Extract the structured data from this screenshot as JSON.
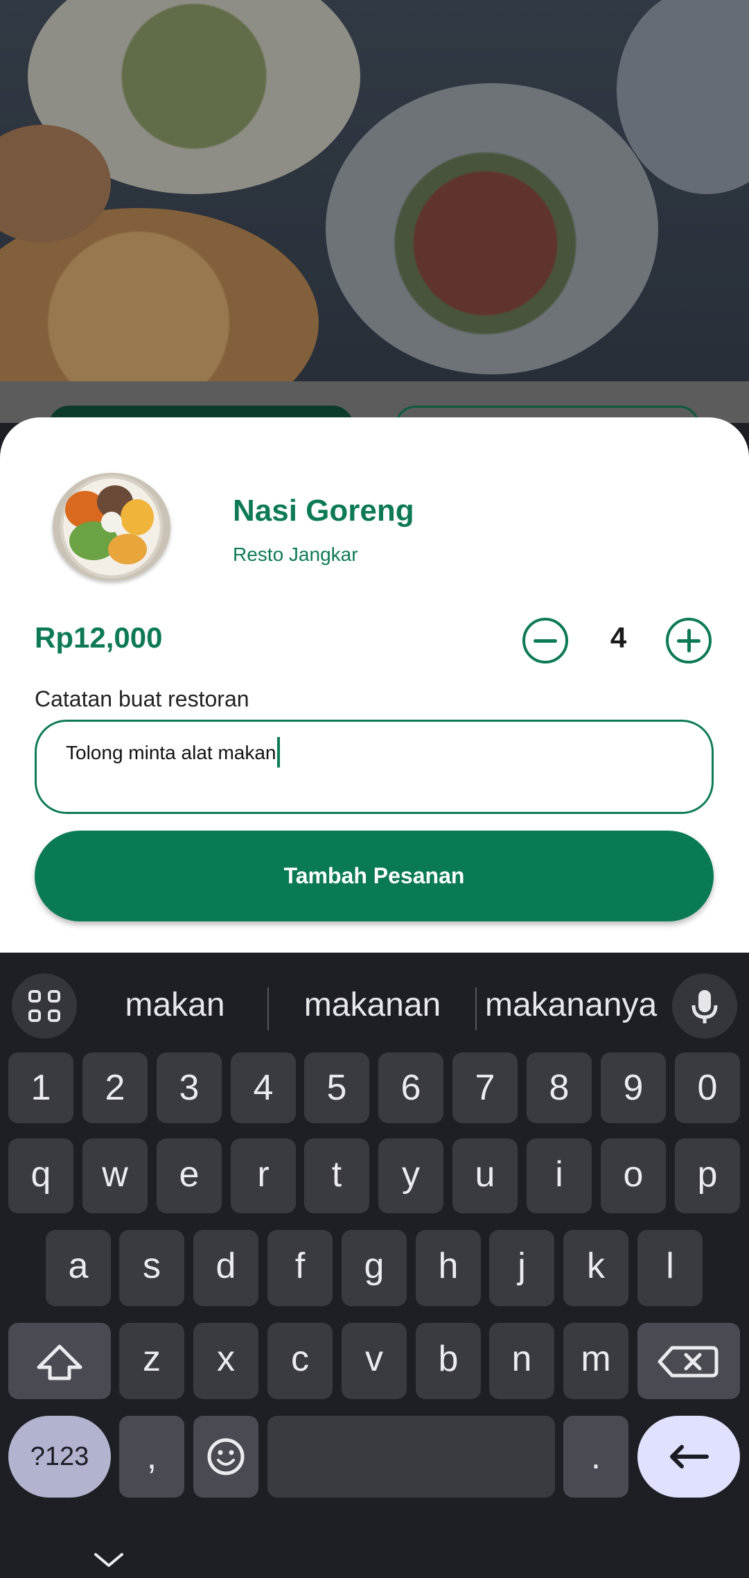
{
  "product": {
    "name": "Nasi Goreng",
    "restaurant": "Resto Jangkar",
    "price": "Rp12,000",
    "quantity": "4"
  },
  "note": {
    "label": "Catatan buat restoran",
    "value": "Tolong minta alat makan"
  },
  "actions": {
    "submit_label": "Tambah Pesanan",
    "decrease_icon": "minus-circle-icon",
    "increase_icon": "plus-circle-icon"
  },
  "keyboard": {
    "suggestions": [
      "makan",
      "makanan",
      "makananya"
    ],
    "row_numbers": [
      "1",
      "2",
      "3",
      "4",
      "5",
      "6",
      "7",
      "8",
      "9",
      "0"
    ],
    "row1": [
      "q",
      "w",
      "e",
      "r",
      "t",
      "y",
      "u",
      "i",
      "o",
      "p"
    ],
    "row2": [
      "a",
      "s",
      "d",
      "f",
      "g",
      "h",
      "j",
      "k",
      "l"
    ],
    "row3": [
      "z",
      "x",
      "c",
      "v",
      "b",
      "n",
      "m"
    ],
    "symbols_label": "?123",
    "comma": ",",
    "period": "."
  },
  "colors": {
    "brand_green": "#0d7a55",
    "keyboard_bg": "#1e1f24",
    "key_bg": "#3a3b41"
  }
}
